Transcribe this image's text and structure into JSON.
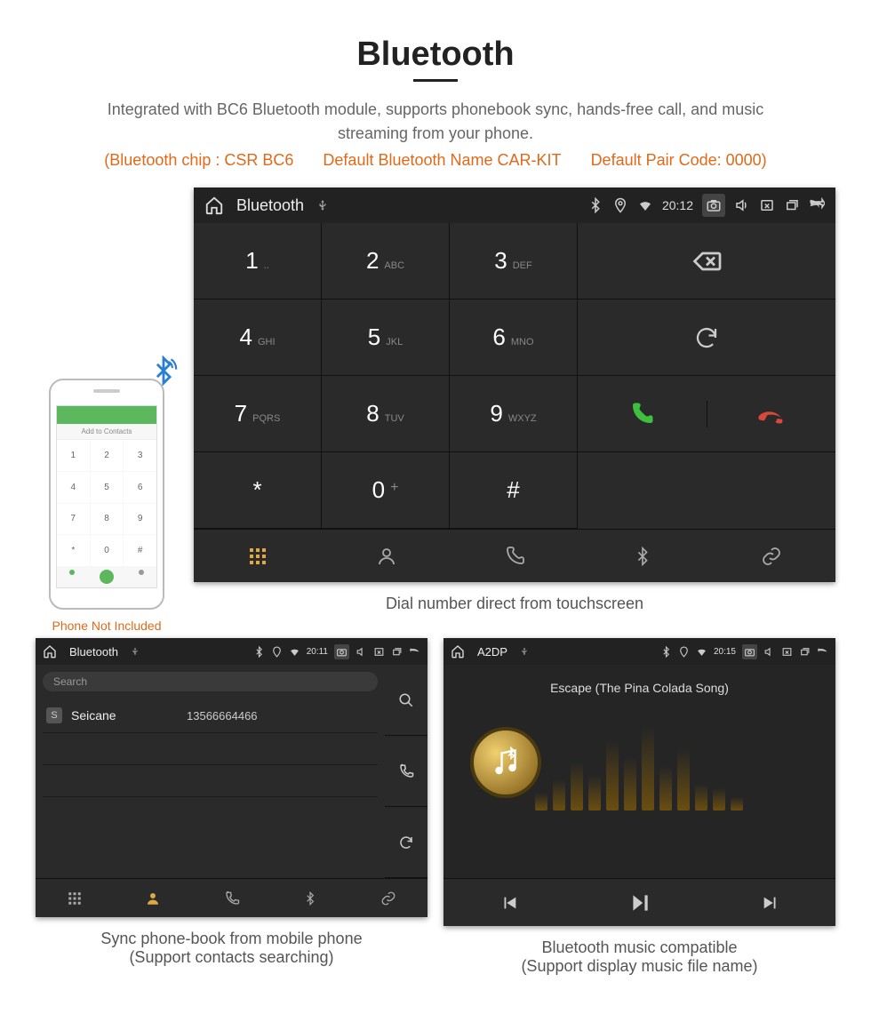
{
  "header": {
    "title": "Bluetooth",
    "subtitle": "Integrated with BC6 Bluetooth module, supports phonebook sync, hands-free call, and music streaming from your phone.",
    "spec_chip": "(Bluetooth chip : CSR BC6",
    "spec_name": "Default Bluetooth Name CAR-KIT",
    "spec_pair": "Default Pair Code: 0000)"
  },
  "phone": {
    "add_contacts": "Add to Contacts",
    "caption": "Phone Not Included"
  },
  "dialer": {
    "statusbar": {
      "title": "Bluetooth",
      "time": "20:12"
    },
    "keys": [
      {
        "n": "1",
        "l": ".."
      },
      {
        "n": "2",
        "l": "ABC"
      },
      {
        "n": "3",
        "l": "DEF"
      },
      {
        "n": "4",
        "l": "GHI"
      },
      {
        "n": "5",
        "l": "JKL"
      },
      {
        "n": "6",
        "l": "MNO"
      },
      {
        "n": "7",
        "l": "PQRS"
      },
      {
        "n": "8",
        "l": "TUV"
      },
      {
        "n": "9",
        "l": "WXYZ"
      },
      {
        "n": "*",
        "l": ""
      },
      {
        "n": "0",
        "l": "+"
      },
      {
        "n": "#",
        "l": ""
      }
    ],
    "caption": "Dial number direct from touchscreen"
  },
  "phonebook": {
    "statusbar": {
      "title": "Bluetooth",
      "time": "20:11"
    },
    "search_placeholder": "Search",
    "contacts": [
      {
        "badge": "S",
        "name": "Seicane",
        "number": "13566664466"
      }
    ],
    "caption_line1": "Sync phone-book from mobile phone",
    "caption_line2": "(Support contacts searching)"
  },
  "music": {
    "statusbar": {
      "title": "A2DP",
      "time": "20:15"
    },
    "track": "Escape (The Pina Colada Song)",
    "caption_line1": "Bluetooth music compatible",
    "caption_line2": "(Support display music file name)"
  }
}
